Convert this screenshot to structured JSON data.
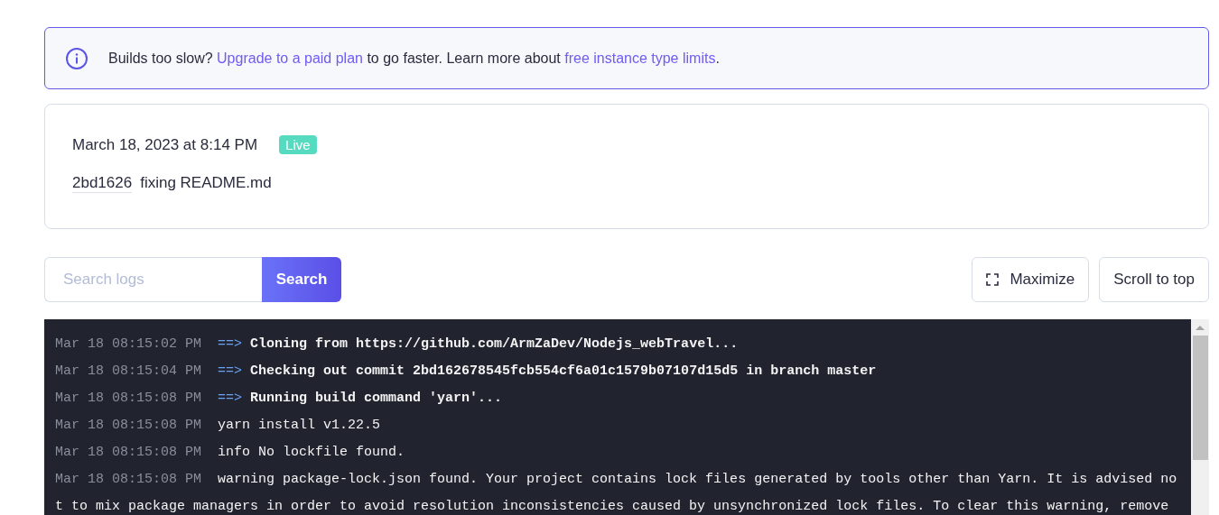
{
  "banner": {
    "parts": [
      {
        "kind": "text",
        "text": "Builds too slow? "
      },
      {
        "kind": "link",
        "text": "Upgrade to a paid plan"
      },
      {
        "kind": "text",
        "text": " to go faster. Learn more about "
      },
      {
        "kind": "link",
        "text": "free instance type limits"
      },
      {
        "kind": "text",
        "text": "."
      }
    ]
  },
  "deploy": {
    "date": "March 18, 2023 at 8:14 PM",
    "status": "Live",
    "commit": "2bd1626",
    "message": "fixing README.md"
  },
  "search": {
    "placeholder": "Search logs",
    "button": "Search"
  },
  "actions": [
    {
      "kind": "maximize",
      "label": "Maximize"
    },
    {
      "kind": "plain",
      "label": "Scroll to top"
    }
  ],
  "logs": [
    {
      "time": "Mar 18 08:15:02 PM",
      "arrow": "==>",
      "text": "Cloning from https://github.com/ArmZaDev/Nodejs_webTravel..."
    },
    {
      "time": "Mar 18 08:15:04 PM",
      "arrow": "==>",
      "text": "Checking out commit 2bd162678545fcb554cf6a01c1579b07107d15d5 in branch master"
    },
    {
      "time": "Mar 18 08:15:08 PM",
      "arrow": "==>",
      "text": "Running build command 'yarn'..."
    },
    {
      "time": "Mar 18 08:15:08 PM",
      "text": "yarn install v1.22.5"
    },
    {
      "time": "Mar 18 08:15:08 PM",
      "text": "info No lockfile found."
    },
    {
      "time": "Mar 18 08:15:08 PM",
      "text": "warning package-lock.json found. Your project contains lock files generated by tools other than Yarn. It is advised not to mix package managers in order to avoid resolution inconsistencies caused by unsynchronized lock files. To clear this warning, remove"
    }
  ]
}
